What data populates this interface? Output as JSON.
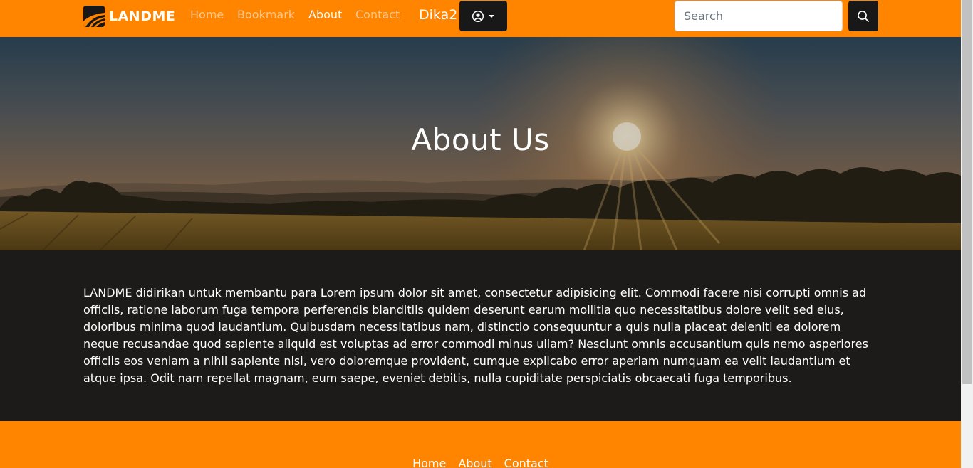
{
  "navbar": {
    "brand": "LANDME",
    "links": [
      {
        "label": "Home",
        "active": false
      },
      {
        "label": "Bookmark",
        "active": false
      },
      {
        "label": "About",
        "active": true
      },
      {
        "label": "Contact",
        "active": false
      }
    ],
    "username": "Dika2",
    "user_icon": "user-circle-icon",
    "search_placeholder": "Search",
    "search_icon": "search-icon"
  },
  "hero": {
    "title": "About Us"
  },
  "content": {
    "paragraph": "LANDME didirikan untuk membantu para Lorem ipsum dolor sit amet, consectetur adipisicing elit. Commodi facere nisi corrupti omnis ad officiis, ratione laborum fuga tempora perferendis blanditiis quidem deserunt earum mollitia quo necessitatibus dolore velit sed eius, doloribus minima quod laudantium. Quibusdam necessitatibus nam, distinctio consequuntur a quis nulla placeat deleniti ea dolorem neque recusandae quod sapiente aliquid est voluptas ad error commodi minus ullam? Nesciunt omnis accusantium quis nemo asperiores officiis eos veniam a nihil sapiente nisi, vero doloremque provident, cumque explicabo error aperiam numquam ea velit laudantium et atque ipsa. Odit nam repellat magnam, eum saepe, eveniet debitis, nulla cupiditate perspiciatis obcaecati fuga temporibus."
  },
  "footer": {
    "links": [
      "Home",
      "About",
      "Contact"
    ]
  },
  "colors": {
    "accent": "#ff8400",
    "dark": "#181818",
    "content_bg": "#1c1b19"
  }
}
